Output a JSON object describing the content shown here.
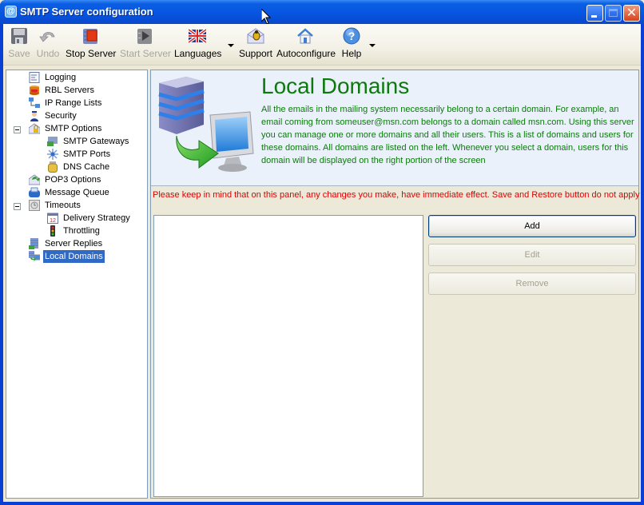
{
  "window": {
    "title": "SMTP Server configuration",
    "controls": {
      "minimize": "_",
      "maximize": "□",
      "close": "✕"
    }
  },
  "toolbar": {
    "items": [
      {
        "label": "Save",
        "icon": "floppy-disk-icon",
        "enabled": false
      },
      {
        "label": "Undo",
        "icon": "undo-arrow-icon",
        "enabled": false
      },
      {
        "label": "Stop Server",
        "icon": "stop-server-icon",
        "enabled": true
      },
      {
        "label": "Start Server",
        "icon": "start-server-icon",
        "enabled": false
      },
      {
        "label": "Languages",
        "icon": "uk-flag-icon",
        "enabled": true,
        "dropdown": true
      },
      {
        "label": "Support",
        "icon": "support-envelope-bug-icon",
        "enabled": true
      },
      {
        "label": "Autoconfigure",
        "icon": "house-icon",
        "enabled": true
      },
      {
        "label": "Help",
        "icon": "help-question-icon",
        "enabled": true,
        "dropdown": true
      }
    ]
  },
  "tree": {
    "items": [
      {
        "label": "Logging",
        "icon": "log-document-icon",
        "level": 0
      },
      {
        "label": "RBL Servers",
        "icon": "rbl-database-icon",
        "level": 0
      },
      {
        "label": "IP Range Lists",
        "icon": "network-computers-icon",
        "level": 0
      },
      {
        "label": "Security",
        "icon": "security-officer-icon",
        "level": 0
      },
      {
        "label": "SMTP Options",
        "icon": "envelope-lock-icon",
        "level": 0,
        "expanded": true
      },
      {
        "label": "SMTP Gateways",
        "icon": "gateway-icon",
        "level": 1
      },
      {
        "label": "SMTP Ports",
        "icon": "ports-icon",
        "level": 1
      },
      {
        "label": "DNS Cache",
        "icon": "dns-cache-jar-icon",
        "level": 1
      },
      {
        "label": "POP3 Options",
        "icon": "pop3-envelope-icon",
        "level": 0
      },
      {
        "label": "Message Queue",
        "icon": "message-queue-icon",
        "level": 0
      },
      {
        "label": "Timeouts",
        "icon": "timeouts-icon",
        "level": 0,
        "expanded": true
      },
      {
        "label": "Delivery Strategy",
        "icon": "calendar-icon",
        "level": 1
      },
      {
        "label": "Throttling",
        "icon": "traffic-light-icon",
        "level": 1
      },
      {
        "label": "Server Replies",
        "icon": "server-replies-icon",
        "level": 0
      },
      {
        "label": "Local Domains",
        "icon": "local-domains-icon",
        "level": 0,
        "selected": true
      }
    ]
  },
  "main": {
    "title": "Local Domains",
    "description": "All the emails in the mailing system necessarily belong to a certain domain. For example, an email coming from someuser@msn.com belongs to a domain called msn.com. Using this server you can manage one or more domains and all their users. This is a list of domains and users for these domains. All domains are listed on the left. Whenever you select a domain, users for this domain will be displayed on the right portion of the screen",
    "warning": "Please keep in mind that on this panel, any changes you make, have immediate effect. Save and Restore button do not apply",
    "domains": [],
    "buttons": {
      "add": "Add",
      "edit": "Edit",
      "remove": "Remove"
    }
  },
  "colors": {
    "title_green": "#0c7a0c",
    "warning_red": "#e00000",
    "selection_blue": "#316ac5",
    "titlebar_blue": "#0654e0"
  }
}
